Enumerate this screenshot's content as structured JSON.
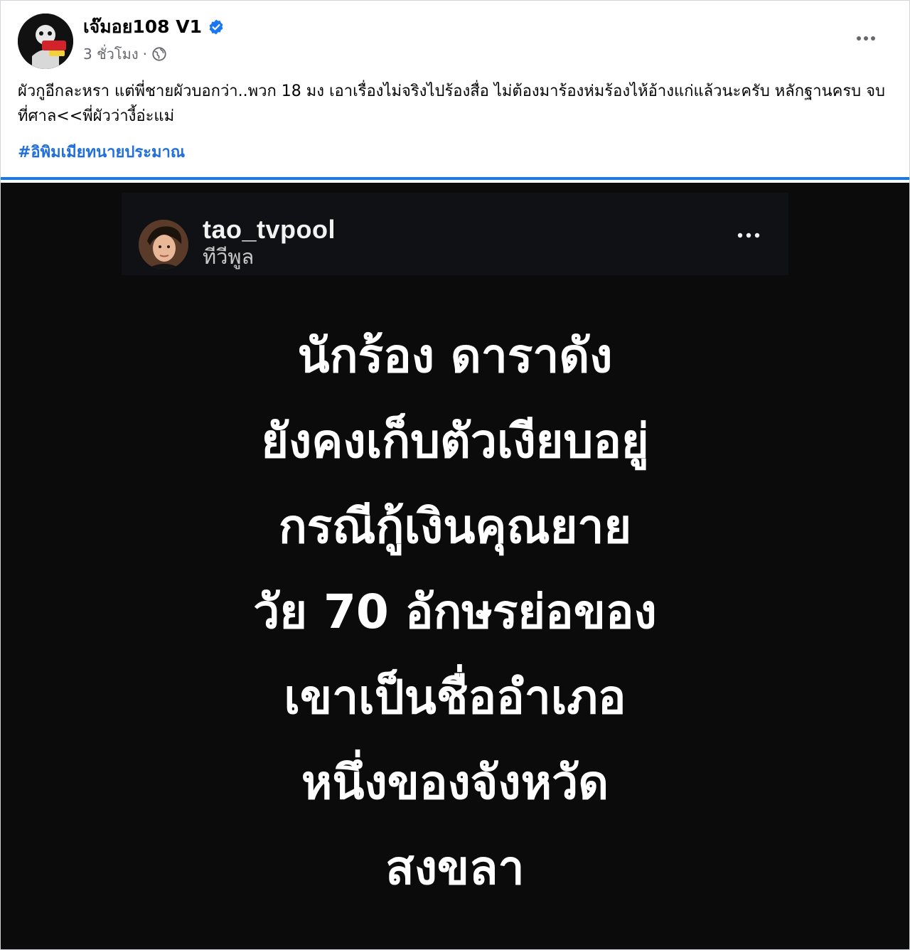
{
  "post": {
    "page_name": "เจ๊มอย108 V1",
    "timestamp": "3 ชั่วโมง",
    "separator": "·",
    "caption": "ผัวกูอีกละหรา แต่พี่ชายผัวบอกว่า..พวก 18 มง เอาเรื่องไม่จริงไปร้องสื่อ ไม่ต้องมาร้องห่มร้องไห้อ้างแก่แล้วนะครับ หลักฐานครบ จบที่ศาล<<พี่ผัวว่างี้อ่ะแม่",
    "hashtag": "#อิพิมเมียทนายประมาณ",
    "icons": {
      "verified": "verified-badge-icon",
      "privacy": "globe-icon",
      "menu": "more-options-icon"
    },
    "colors": {
      "verified": "#1877f2",
      "hashtag": "#216fdb",
      "meta": "#65676b"
    }
  },
  "image": {
    "instagram_header": {
      "username": "tao_tvpool",
      "subtitle": "ทีวีพูล",
      "menu_icon": "more-horizontal-icon"
    },
    "story_lines": [
      "นักร้อง ดาราดัง",
      "ยังคงเก็บตัวเงียบอยู่",
      "กรณีกู้เงินคุณยาย",
      "วัย 70 อักษรย่อของ",
      "เขาเป็นชื่ออำเภอ",
      "หนึ่งของจังหวัด",
      "สงขลา"
    ],
    "background": "#0b0b0b",
    "text_color": "#ffffff"
  }
}
